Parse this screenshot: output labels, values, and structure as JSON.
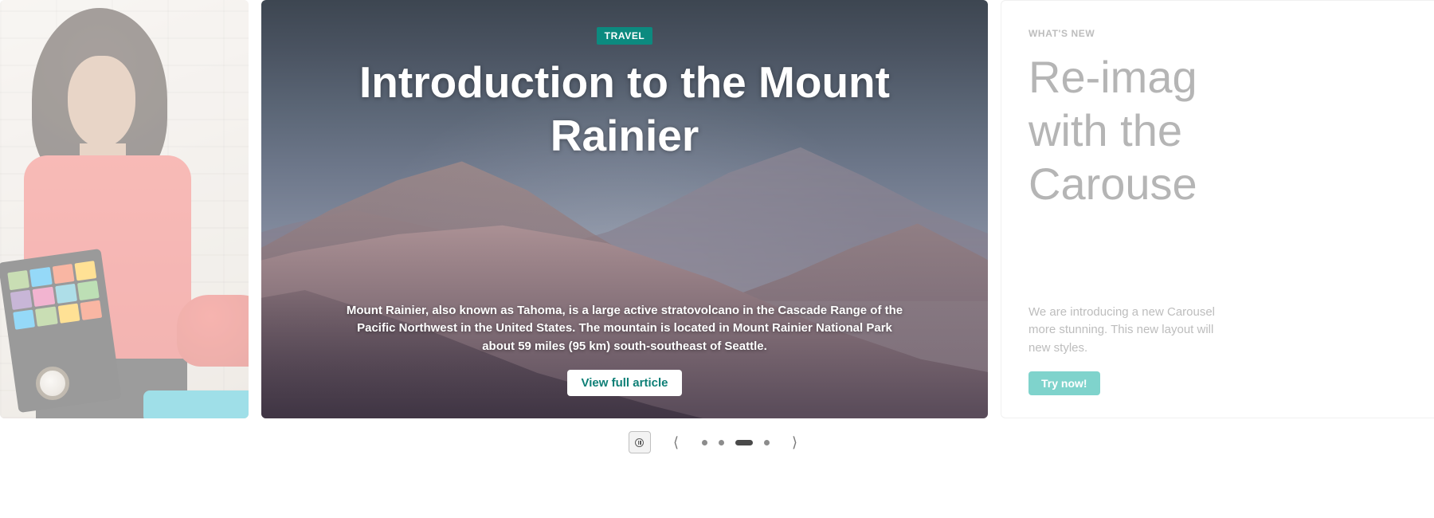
{
  "carousel": {
    "active_index": 2,
    "slide_count": 4,
    "slides": {
      "center": {
        "category": "TRAVEL",
        "title": "Introduction to the Mount Rainier",
        "description": "Mount Rainier, also known as Tahoma, is a large active stratovolcano in the Cascade Range of the Pacific Northwest in the United States. The mountain is located in Mount Rainier National Park about 59 miles (95 km) south-southeast of Seattle.",
        "button_label": "View full article"
      },
      "right": {
        "eyebrow": "WHAT'S NEW",
        "title_line1": "Re-imag",
        "title_line2": "with the",
        "title_line3": "Carouse",
        "body_line1": "We are introducing a new Carousel",
        "body_line2": "more stunning. This new layout will",
        "body_line3": "new styles.",
        "button_label": "Try now!"
      }
    },
    "controls": {
      "pause_label": "Pause",
      "prev_label": "Previous",
      "next_label": "Next"
    }
  },
  "colors": {
    "badge_bg": "#0c8a7f",
    "hero_button_text": "#0d7f76",
    "cta_bg": "#3bbdb2"
  }
}
